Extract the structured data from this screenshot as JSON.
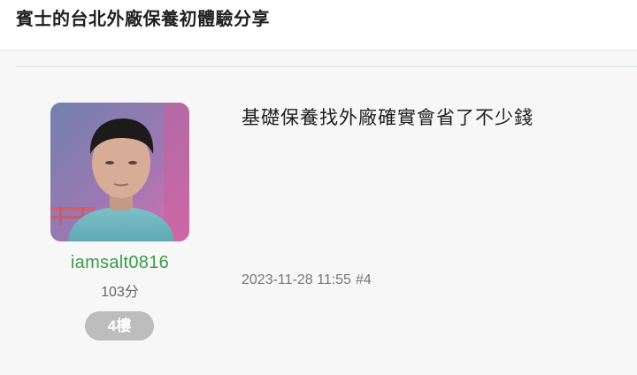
{
  "page": {
    "title": "賓士的台北外廠保養初體驗分享"
  },
  "post": {
    "user": {
      "name": "iamsalt0816",
      "score": "103分"
    },
    "floor_label": "4樓",
    "content": "基礎保養找外廠確實會省了不少錢",
    "timestamp": "2023-11-28 11:55",
    "post_number": "#4"
  },
  "colors": {
    "username": "#3a9b4a",
    "badge_bg": "#bdbdbd",
    "divider": "#d6e6e6",
    "page_bg": "#f7f7f7"
  },
  "icons": {
    "avatar": "user-avatar-photo"
  }
}
